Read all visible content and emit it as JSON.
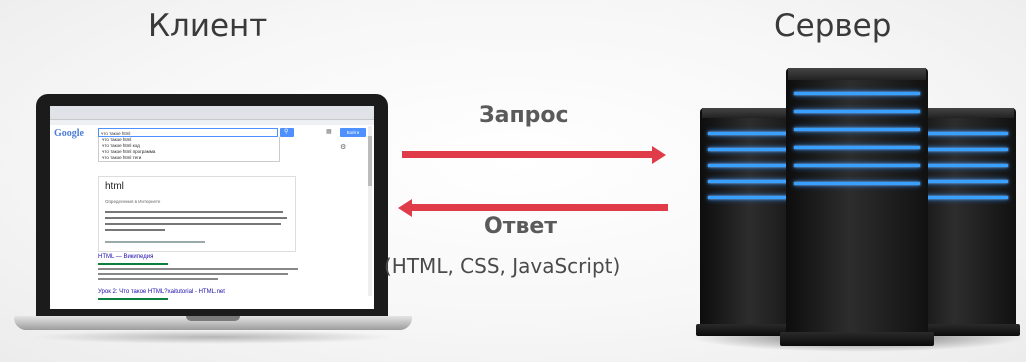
{
  "titles": {
    "client": "Клиент",
    "server": "Сервер"
  },
  "arrows": {
    "request": "Запрос",
    "response": "Ответ",
    "response_formats": "(HTML, CSS, JavaScript)",
    "color": "#e03b48"
  },
  "browser": {
    "logo": "Google",
    "search_value": "что такое html",
    "suggestions": [
      "что такое html",
      "что такое html код",
      "что такое html программа",
      "что такое html теги"
    ],
    "signin_label": "Войти",
    "knowledge_title": "html",
    "knowledge_subtitle": "Определения в Интернете",
    "result_1_title": "HTML — Википедия",
    "result_2_title": "Урок 2: Что такое HTML?xaitutorial - HTML.net",
    "search_color": "#4d90fe"
  },
  "server_glow_color": "#3aa0ff"
}
